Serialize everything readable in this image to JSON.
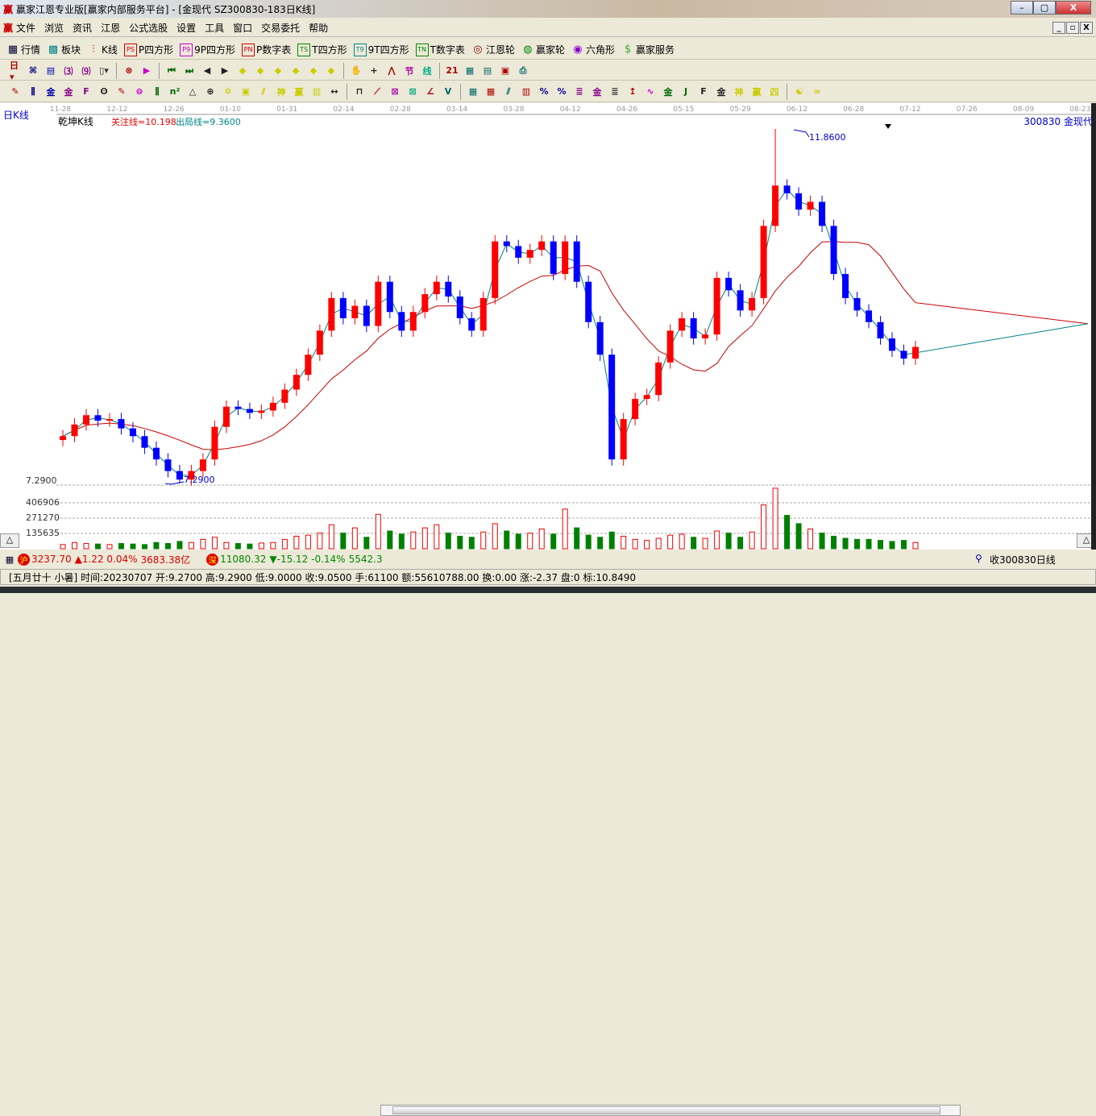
{
  "window": {
    "title": "赢家江恩专业版[赢家内部服务平台] - [金现代  SZ300830-183日K线]",
    "logo": "赢",
    "min": "–",
    "max": "▢",
    "close": "X"
  },
  "menu": [
    "文件",
    "浏览",
    "资讯",
    "江恩",
    "公式选股",
    "设置",
    "工具",
    "窗口",
    "交易委托",
    "帮助"
  ],
  "mdi": [
    "_",
    "▫",
    "X"
  ],
  "toolbar1": [
    {
      "icon": "grid-table-icon",
      "g": "▦",
      "label": "行情",
      "c": "#003"
    },
    {
      "icon": "blocks-icon",
      "g": "▩",
      "label": "板块",
      "c": "#088"
    },
    {
      "icon": "kline-icon",
      "g": "⫶",
      "label": "K线",
      "c": "#c00"
    },
    {
      "icon": "ps-icon",
      "g": "PS",
      "label": "P四方形",
      "c": "#c00"
    },
    {
      "icon": "p9-icon",
      "g": "P9",
      "label": "9P四方形",
      "c": "#c0c"
    },
    {
      "icon": "pn-icon",
      "g": "PN",
      "label": "P数字表",
      "c": "#c00"
    },
    {
      "icon": "ts-icon",
      "g": "TS",
      "label": "T四方形",
      "c": "#080"
    },
    {
      "icon": "t9-icon",
      "g": "T9",
      "label": "9T四方形",
      "c": "#088"
    },
    {
      "icon": "tn-icon",
      "g": "TN",
      "label": "T数字表",
      "c": "#080"
    },
    {
      "icon": "gann-wheel-icon",
      "g": "◎",
      "label": "江恩轮",
      "c": "#800"
    },
    {
      "icon": "winner-wheel-icon",
      "g": "◍",
      "label": "赢家轮",
      "c": "#080"
    },
    {
      "icon": "hexagon-icon",
      "g": "◉",
      "label": "六角形",
      "c": "#80c"
    },
    {
      "icon": "dollar-icon",
      "g": "$",
      "label": "赢家服务",
      "c": "#3a3"
    }
  ],
  "toolbar2": [
    "day-period-dropdown:日▾",
    "draw-icon:⌘",
    "notes-icon:▤",
    "period3-icon:⑶",
    "period9-icon:⑼",
    "candle-type-icon:▯▾",
    "cancel-icon:⊗",
    "flag-icon:▶",
    "first-icon:⏮",
    "last-icon:⏭",
    "prev-icon:◀",
    "next-icon:▶",
    "left-icon:◆",
    "right-icon:◆",
    "expand-icon:◆",
    "shrink-icon:◆",
    "zoom-in-icon:◆",
    "zoom-out-icon:◆",
    "hand-icon:✋",
    "crosshair-icon:+",
    "wave-icon:⋀",
    "node-icon:节",
    "line-icon:线",
    "calendar-icon:21",
    "calculator-icon:▦",
    "book-icon:▤",
    "save-icon:▣",
    "print-icon:⎙"
  ],
  "toolbar3": [
    "pen-icon:✎",
    "lines-icon:⫼",
    "gold-lines-icon:金",
    "gold-lines2-icon:金",
    "f-lines-icon:F",
    "spiral-icon:ʘ",
    "pen2-icon:✎",
    "circle-grid-icon:⊜",
    "parallel-icon:⫼",
    "n2-icon:n²",
    "triangle-icon:△",
    "target-icon:⊕",
    "star-icon:✲",
    "square-icon:▣",
    "fan-icon:⫽",
    "shen-icon:神",
    "ying-icon:赢",
    "grid-icon:▥",
    "range-icon:↔",
    "box-icon:⊓",
    "fan2-icon:⟋",
    "fan3-icon:⊠",
    "fan4-icon:⊠",
    "angle-icon:∠",
    "v-icon:V",
    "grid2-icon:▦",
    "grid3-icon:▦",
    "slash-icon:⫽",
    "bars-icon:▥",
    "pct-icon:%",
    "pct2-icon:%",
    "pct3-icon:≣",
    "gold-icon:金",
    "gold2-icon:≣",
    "arrow-icon:↥",
    "wave2-icon:∿",
    "gold3-icon:金",
    "j-icon:J",
    "f-icon:F",
    "gold4-icon:金",
    "shen2-icon:神",
    "ying2-icon:赢",
    "si-icon:四",
    "yinyang-icon:☯",
    "infinity-icon:∞"
  ],
  "chart": {
    "period_label": "日K线",
    "indicator_name": "乾坤K线",
    "focus_line": "关注线=10.198",
    "exit_line": "出局线=9.3600",
    "stock": "300830 金现代",
    "high_label": "11.8600",
    "low_label": "7.2900",
    "price_axis_label": "7.2900",
    "volume_ticks": [
      "406906",
      "271270",
      "135635"
    ],
    "collapse_button": "△",
    "dates": [
      "11-28",
      "12-12",
      "12-26",
      "01-10",
      "01-31",
      "02-14",
      "02-28",
      "03-14",
      "03-28",
      "04-12",
      "04-26",
      "05-15",
      "05-29",
      "06-12",
      "06-28",
      "07-12",
      "07-26",
      "08-09",
      "08-23"
    ],
    "colors": {
      "up": "#ff0000",
      "down": "#0000ff",
      "volume_down": "#008000",
      "ma_fast": "#008080",
      "ma_slow": "#cc0000"
    }
  },
  "chart_data": {
    "type": "candlestick",
    "price_range": [
      7.29,
      11.86
    ],
    "volume_max": 610000,
    "closes": [
      7.9,
      8.05,
      8.17,
      8.1,
      8.12,
      8.0,
      7.9,
      7.75,
      7.6,
      7.45,
      7.34,
      7.45,
      7.6,
      8.02,
      8.28,
      8.25,
      8.2,
      8.23,
      8.33,
      8.5,
      8.69,
      8.95,
      9.26,
      9.68,
      9.42,
      9.58,
      9.32,
      9.89,
      9.5,
      9.26,
      9.5,
      9.73,
      9.89,
      9.7,
      9.42,
      9.26,
      9.68,
      10.41,
      10.35,
      10.2,
      10.3,
      10.41,
      9.99,
      10.41,
      9.89,
      9.37,
      8.95,
      7.6,
      8.12,
      8.38,
      8.43,
      8.85,
      9.26,
      9.42,
      9.16,
      9.21,
      9.94,
      9.78,
      9.52,
      9.68,
      10.61,
      11.13,
      11.03,
      10.82,
      10.92,
      10.61,
      9.99,
      9.68,
      9.52,
      9.37,
      9.16,
      9.0,
      8.9,
      9.05
    ],
    "volumes": [
      40000,
      60000,
      50000,
      45000,
      40000,
      50000,
      45000,
      40000,
      60000,
      50000,
      70000,
      60000,
      90000,
      110000,
      60000,
      50000,
      45000,
      55000,
      60000,
      90000,
      120000,
      130000,
      150000,
      230000,
      150000,
      200000,
      110000,
      330000,
      170000,
      140000,
      160000,
      200000,
      230000,
      150000,
      120000,
      110000,
      160000,
      240000,
      170000,
      140000,
      150000,
      190000,
      140000,
      380000,
      200000,
      130000,
      110000,
      160000,
      120000,
      90000,
      80000,
      100000,
      130000,
      140000,
      110000,
      100000,
      170000,
      150000,
      110000,
      160000,
      420000,
      580000,
      320000,
      240000,
      190000,
      150000,
      120000,
      100000,
      90000,
      90000,
      80000,
      70000,
      80000,
      60000
    ]
  },
  "status": {
    "sh_badge": "沪",
    "sh_index": "3237.70",
    "sh_change": "▲1.22 0.04%",
    "sh_amount": "3683.38亿",
    "sz_badge": "深",
    "sz_index": "11080.32",
    "sz_change": "▼-15.12 -0.14%",
    "sz_amount": "5542.3",
    "receive": "收300830日线",
    "info": "[五月廿十 小暑] 时间:20230707 开:9.2700 高:9.2900 低:9.0000 收:9.0500 手:61100 额:55610788.00 换:0.00 涨:-2.37 盘:0 标:10.8490"
  }
}
